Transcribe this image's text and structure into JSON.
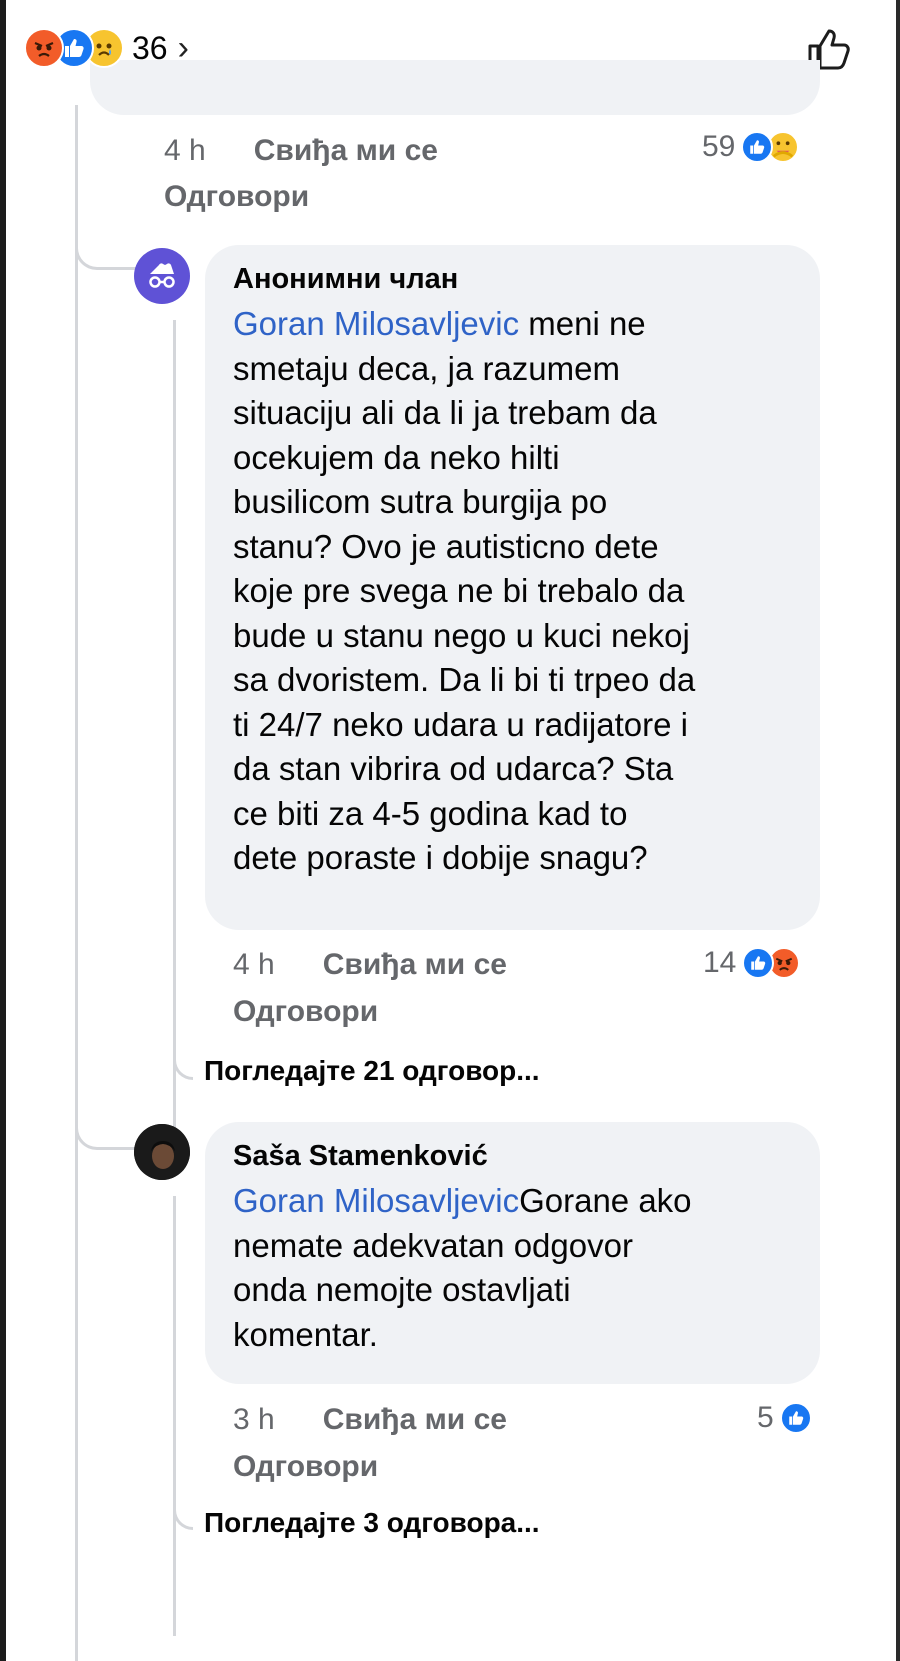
{
  "top_bar": {
    "reaction_count": "36",
    "chevron": "›",
    "reaction_icons": [
      "angry-icon",
      "like-icon",
      "sad-icon"
    ]
  },
  "comment0": {
    "time": "4 h",
    "like_label": "Свиђа ми се",
    "reply_label": "Одговори",
    "reaction_count": "59",
    "reaction_icons": [
      "like-icon",
      "care-icon"
    ]
  },
  "comment1": {
    "author": "Анонимни члан",
    "mention": "Goran Milosavljevic",
    "text": " meni ne\nsmetaju deca, ja razumem\nsituaciju ali da li ja trebam da\nocekujem da neko hilti\nbusilicom sutra burgija po\nstanu? Ovo je autisticno dete\nkoje pre svega ne bi trebalo da\nbude u stanu nego u kuci nekoj\nsa dvoristem. Da li bi ti trpeo da\nti 24/7 neko udara u radijatore i\nda stan vibrira od udarca? Sta\nce biti za 4-5 godina kad to\ndete poraste i dobije snagu?",
    "time": "4 h",
    "like_label": "Свиђа ми се",
    "reply_label": "Одговори",
    "reaction_count": "14",
    "reaction_icons": [
      "like-icon",
      "angry-icon"
    ],
    "view_replies": "Погледајте 21 одговор..."
  },
  "comment2": {
    "author": "Saša Stamenković",
    "mention": "Goran Milosavljevic",
    "text": "Gorane ako\nnemate adekvatan odgovor\nonda nemojte ostavljati\nkomentar.",
    "time": "3 h",
    "like_label": "Свиђа ми се",
    "reply_label": "Одговори",
    "reaction_count": "5",
    "reaction_icons": [
      "like-icon"
    ],
    "view_replies": "Погледајте 3 одговора..."
  },
  "colors": {
    "bubble": "#f0f2f5",
    "mention": "#2f63c7",
    "meta": "#65676b",
    "like_blue": "#1877f2",
    "angry": "#f25c29",
    "care_yellow": "#f7c42f"
  }
}
